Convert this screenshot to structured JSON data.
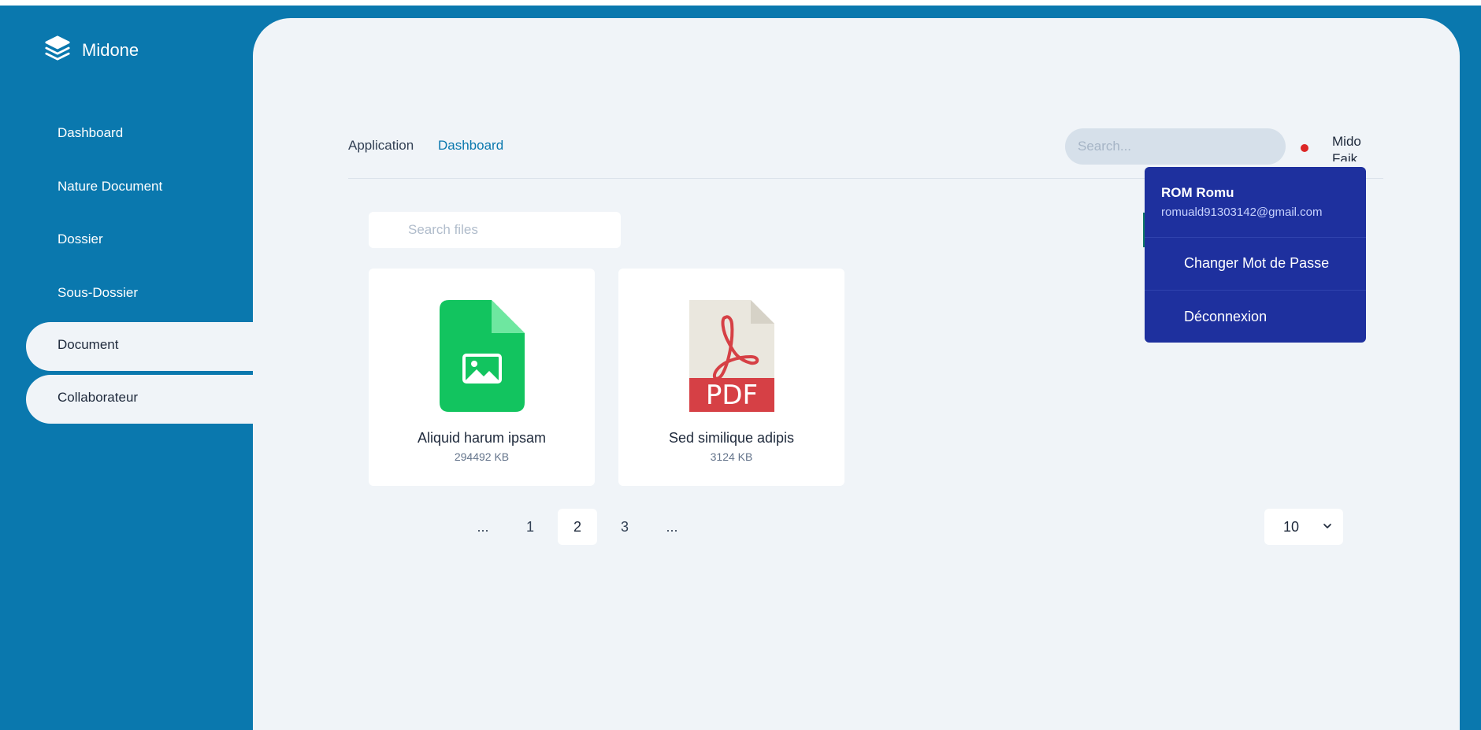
{
  "brand": {
    "name": "Midone",
    "icon": "layers-icon"
  },
  "sidebar": {
    "items": [
      {
        "label": "Dashboard",
        "active": false
      },
      {
        "label": "Nature Document",
        "active": false
      },
      {
        "label": "Dossier",
        "active": false
      },
      {
        "label": "Sous-Dossier",
        "active": false
      },
      {
        "label": "Document",
        "active": true
      },
      {
        "label": "Collaborateur",
        "active": true
      }
    ]
  },
  "topbar": {
    "breadcrumb": [
      "Application",
      "Dashboard"
    ],
    "search_placeholder": "Search...",
    "avatar_text": "Mido Faik"
  },
  "user_menu": {
    "name": "ROM Romu",
    "email": "romuald91303142@gmail.com",
    "items": [
      "Changer Mot de Passe",
      "Déconnexion"
    ]
  },
  "files": {
    "search_placeholder": "Search files",
    "items": [
      {
        "name": "Aliquid harum ipsam",
        "size": "294492 KB",
        "type": "image-file-icon"
      },
      {
        "name": "Sed similique adipis",
        "size": "3124 KB",
        "type": "pdf-file-icon",
        "badge": "PDF"
      }
    ]
  },
  "pagination": {
    "pages": [
      "...",
      "1",
      "2",
      "3",
      "..."
    ],
    "current": "2",
    "per_page": "10"
  },
  "colors": {
    "primary": "#0a78ae",
    "background": "#f0f4f8",
    "dropdown": "#1e309e",
    "notification": "#dc2626",
    "image_file": "#12c45f",
    "pdf_red": "#d64045"
  }
}
